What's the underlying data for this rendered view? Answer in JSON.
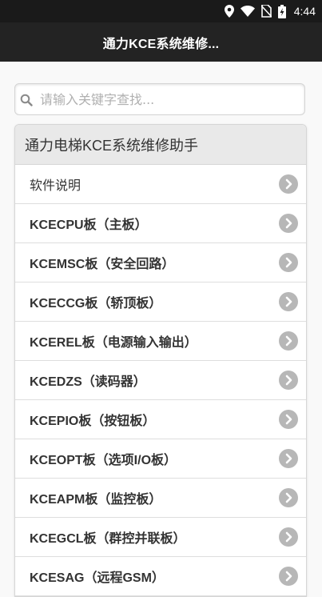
{
  "status_bar": {
    "time": "4:44"
  },
  "app_bar": {
    "title": "通力KCE系统维修..."
  },
  "search": {
    "placeholder": "请输入关键字查找..."
  },
  "list": {
    "header": "通力电梯KCE系统维修助手",
    "items": [
      {
        "label": "软件说明"
      },
      {
        "label": "KCECPU板（主板）"
      },
      {
        "label": "KCEMSC板（安全回路）"
      },
      {
        "label": "KCECCG板（轿顶板）"
      },
      {
        "label": "KCEREL板（电源输入输出）"
      },
      {
        "label": "KCEDZS（读码器）"
      },
      {
        "label": "KCEPIO板（按钮板）"
      },
      {
        "label": "KCEOPT板（选项I/O板）"
      },
      {
        "label": "KCEAPM板（监控板）"
      },
      {
        "label": "KCEGCL板（群控并联板）"
      },
      {
        "label": "KCESAG（远程GSM）"
      }
    ]
  }
}
